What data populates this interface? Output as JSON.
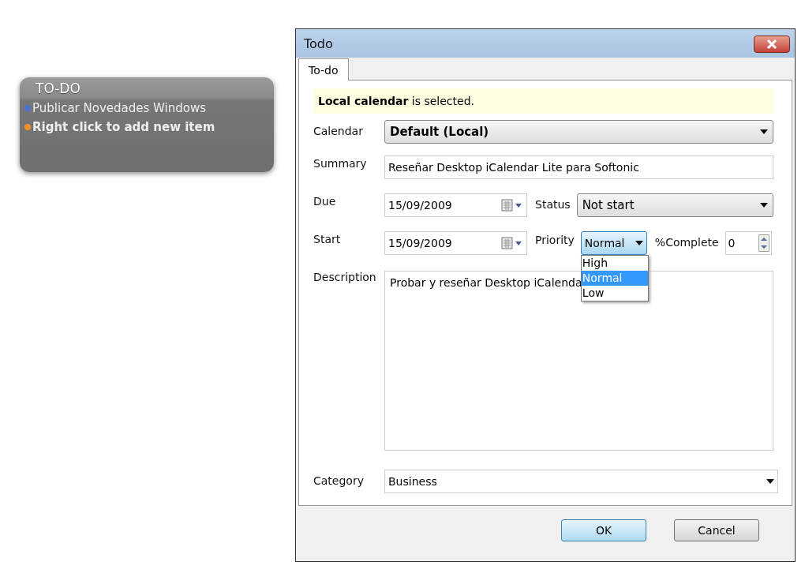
{
  "widget": {
    "title": "TO-DO",
    "items": [
      {
        "text": "Publicar Novedades Windows",
        "color": "#4a74d0",
        "kind": "item"
      },
      {
        "text": "Right click to add new item",
        "color": "#f0902a",
        "kind": "hint"
      }
    ]
  },
  "window": {
    "title": "Todo"
  },
  "tabs": [
    {
      "label": "To-do",
      "selected": true
    }
  ],
  "info": "**Local calendar** is selected.",
  "form": {
    "calendar": {
      "label": "Calendar",
      "value": "Default (Local)"
    },
    "summary": {
      "label": "Summary",
      "value": "Reseñar Desktop iCalendar Lite para Softonic"
    },
    "due": {
      "label": "Due",
      "value": "15/09/2009"
    },
    "status": {
      "label": "Status",
      "value": "Not start"
    },
    "start": {
      "label": "Start",
      "value": "15/09/2009"
    },
    "priority": {
      "label": "Priority",
      "value": "Normal",
      "expanded": true,
      "options": [
        {
          "label": "High",
          "selected": false
        },
        {
          "label": "Normal",
          "selected": true
        },
        {
          "label": "Low",
          "selected": false
        }
      ]
    },
    "complete": {
      "label": "%Complete",
      "value": "0"
    },
    "description": {
      "label": "Description",
      "value": "Probar y reseñar Desktop iCalenda"
    },
    "category": {
      "label": "Category",
      "value": "Business"
    }
  },
  "buttons": [
    {
      "label": "OK",
      "default": true
    },
    {
      "label": "Cancel",
      "default": false
    }
  ]
}
